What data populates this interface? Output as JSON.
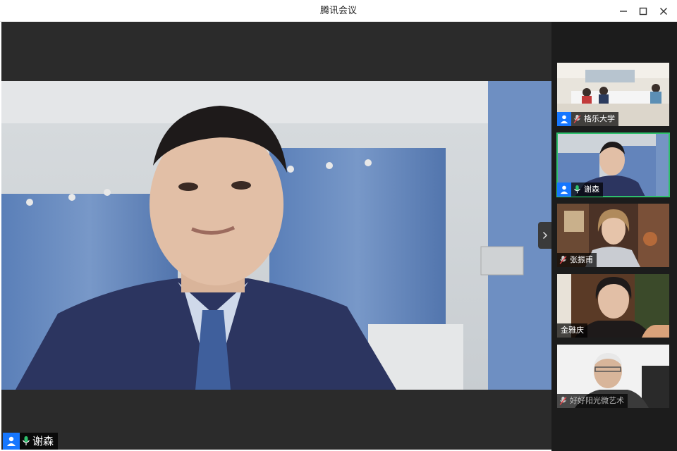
{
  "window": {
    "title": "腾讯会议",
    "controls": [
      "minimize-icon",
      "maximize-icon",
      "close-icon"
    ]
  },
  "main_speaker": {
    "name": "谢森",
    "mic": "on",
    "avatar_icon": "user-icon"
  },
  "participants": [
    {
      "name": "格乐大学",
      "mic": "muted",
      "avatar_icon": "user-icon",
      "active": false
    },
    {
      "name": "谢森",
      "mic": "on",
      "avatar_icon": "user-icon",
      "active": true
    },
    {
      "name": "张振甫",
      "mic": "muted",
      "active": false
    },
    {
      "name": "金雅庆",
      "mic": "none",
      "active": false
    },
    {
      "name": "好好阳光微艺术",
      "mic": "muted",
      "active": false
    }
  ],
  "colors": {
    "accent_blue": "#1677ff",
    "speaking_green": "#2fc06d",
    "muted_red": "#e5484d",
    "sidebar_bg": "#1c1c1c",
    "stage_bg": "#2b2b2b"
  }
}
